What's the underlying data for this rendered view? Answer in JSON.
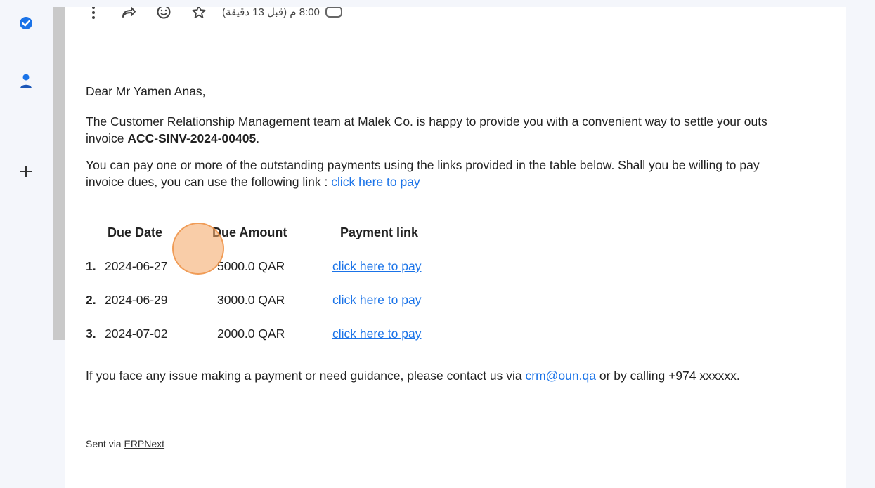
{
  "colors": {
    "accent": "#1a73e8",
    "rail_background": "#f4f6fb",
    "cursor_highlight": "#f4a460",
    "scrollbar": "#c9c9c9"
  },
  "left_rail": {
    "items": [
      {
        "icon": "tasks-check-icon"
      },
      {
        "icon": "contacts-person-icon"
      },
      {
        "icon": "add-plus-icon"
      }
    ]
  },
  "toolbar": {
    "icons": [
      "more-vertical-icon",
      "forward-icon",
      "emoji-icon",
      "star-icon"
    ],
    "time_text": "8:00 م (قبل 13 دقيقة)",
    "attachment_icon": "attachment-icon"
  },
  "email": {
    "greeting": "Dear Mr Yamen Anas,",
    "intro_line1": "The Customer Relationship Management team at Malek Co. is happy to provide you with a convenient way to settle your outs",
    "intro_line2_prefix": "invoice ",
    "invoice_number": "ACC-SINV-2024-00405",
    "intro_line2_suffix": ".",
    "pay_line1": "You can pay one or more of the outstanding payments using the links provided in the table below. Shall you be willing to pay",
    "pay_line2_prefix": "invoice dues, you can use the following link : ",
    "pay_all_link": "click here to pay",
    "table": {
      "headers": [
        "Due Date",
        "Due Amount",
        "Payment link"
      ],
      "rows": [
        {
          "num": "1.",
          "date": "2024-06-27",
          "amount": "5000.0 QAR",
          "link": "click here to pay"
        },
        {
          "num": "2.",
          "date": "2024-06-29",
          "amount": "3000.0 QAR",
          "link": "click here to pay"
        },
        {
          "num": "3.",
          "date": "2024-07-02",
          "amount": "2000.0 QAR",
          "link": "click here to pay"
        }
      ]
    },
    "contact_prefix": "If you face any issue making a payment or need guidance, please contact us via ",
    "contact_email": "crm@oun.qa",
    "contact_suffix": " or by calling +974 xxxxxx.",
    "sent_via_prefix": "Sent via ",
    "sent_via_link": "ERPNext"
  }
}
